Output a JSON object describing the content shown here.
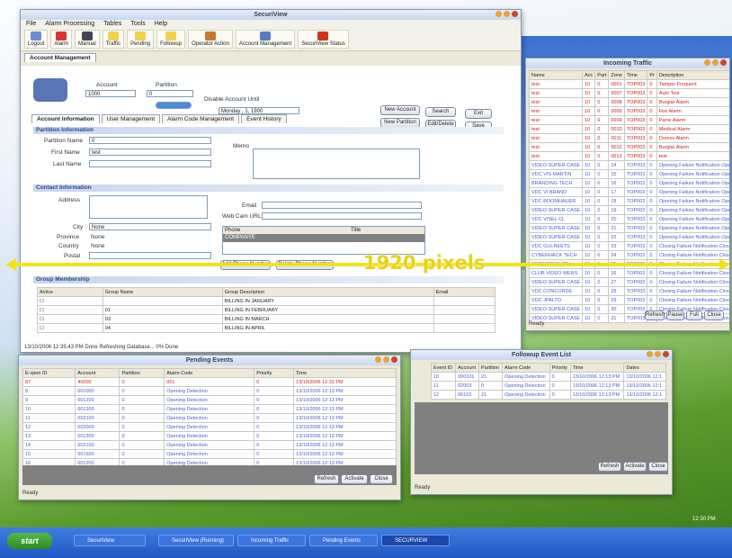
{
  "annotation_text": "1920 pixels",
  "main_window": {
    "title": "SecuriView",
    "menu": [
      "File",
      "Alarm Processing",
      "Tables",
      "Tools",
      "Help"
    ],
    "toolbar": [
      "Logout",
      "Alarm",
      "Manual",
      "Traffic",
      "Pending",
      "Followup",
      "Operator Action",
      "Account Management",
      "SecuriView Status"
    ],
    "doc_tab": "Account Management",
    "account_label": "Account",
    "account_value": "1000",
    "partition_label": "Partition",
    "partition_value": "0",
    "disable_label": "Disable Account Until",
    "date_value": "Monday , 1, 1900",
    "buttons": {
      "new_account": "New Account",
      "search": "Search",
      "exit": "Exit",
      "new_partition": "New Partition",
      "edit_delete": "Edit/Delete",
      "save": "Save"
    },
    "sub_tabs": [
      "Account Information",
      "User Management",
      "Alarm Code Management",
      "Event History"
    ],
    "partition_info": "Partition Information",
    "partition_name_label": "Partition Name",
    "partition_name_value": "0",
    "first_name_label": "First Name",
    "first_name_value": "test",
    "last_name_label": "Last Name",
    "memo_label": "Memo",
    "contact_info": "Contact Information",
    "address_label": "Address",
    "email_label": "Email",
    "webcam_label": "Web Cam URL",
    "city_label": "City",
    "city_value": "None",
    "province_label": "Province",
    "province_value": "None",
    "country_label": "Country",
    "country_value": "None",
    "postal_label": "Postal",
    "phone_headers": [
      "Phone",
      "Title"
    ],
    "phone_row": "COMPANYE",
    "add_phone": "Add Phone Number",
    "delete_phone": "Delete Phone Number",
    "group_title": "Group Membership",
    "group_headers": [
      "Active",
      "Group Name",
      "Group Description",
      "Email"
    ],
    "group_rows": [
      [
        "",
        "BILLING IN JANUARY"
      ],
      [
        "01",
        "BILLING IN FEBRUARY"
      ],
      [
        "03",
        "BILLING IN MARCH"
      ],
      [
        "04",
        "BILLING IN APRIL"
      ]
    ],
    "status": "13/10/2006 12:35:43 PM   Done Refreshing Database... 0% Done"
  },
  "incoming_traffic": {
    "title": "Incoming Traffic",
    "headers": [
      "Name",
      "Acc",
      "Part",
      "Zone",
      "Time",
      "Pr",
      "Description"
    ],
    "rows": [
      [
        "test",
        "10",
        "0",
        "0001",
        "TOP003",
        "0",
        "Tamper Frequent"
      ],
      [
        "test",
        "10",
        "0",
        "0007",
        "TOP003",
        "0",
        "Auto Test"
      ],
      [
        "test",
        "10",
        "0",
        "0008",
        "TOP003",
        "0",
        "Burglar Alarm"
      ],
      [
        "test",
        "10",
        "0",
        "0009",
        "TOP003",
        "0",
        "Fire Alarm"
      ],
      [
        "test",
        "10",
        "0",
        "0009",
        "TOP003",
        "0",
        "Panic Alarm"
      ],
      [
        "test",
        "10",
        "0",
        "0010",
        "TOP003",
        "0",
        "Medical Alarm"
      ],
      [
        "test",
        "10",
        "0",
        "0011",
        "TOP003",
        "0",
        "Duress Alarm"
      ],
      [
        "test",
        "10",
        "0",
        "0012",
        "TOP003",
        "0",
        "Burglar Alarm"
      ],
      [
        "test",
        "10",
        "0",
        "0013",
        "TOP003",
        "0",
        "test"
      ],
      [
        "VIDEO SUPER CASE",
        "10",
        "0",
        "14",
        "TOP003",
        "0",
        "Opening Failure Notification Opening"
      ],
      [
        "VDC VIS MARTIN",
        "10",
        "0",
        "15",
        "TOP003",
        "0",
        "Opening Failure Notification Opening"
      ],
      [
        "BRANDING TECH",
        "10",
        "0",
        "16",
        "TOP003",
        "0",
        "Opening Failure Notification Opening"
      ],
      [
        "VDC VI BRAND",
        "10",
        "0",
        "17",
        "TOP003",
        "0",
        "Opening Failure Notification Opening"
      ],
      [
        "VDC BOOMHAUER",
        "10",
        "0",
        "18",
        "TOP003",
        "0",
        "Opening Failure Notification Opening"
      ],
      [
        "VIDEO SUPER CASE",
        "10",
        "0",
        "19",
        "TOP003",
        "0",
        "Opening Failure Notification Opening"
      ],
      [
        "VDC VISEL CL",
        "10",
        "0",
        "20",
        "TOP003",
        "0",
        "Opening Failure Notification Opening"
      ],
      [
        "VIDEO SUPER CASE",
        "10",
        "0",
        "21",
        "TOP003",
        "0",
        "Opening Failure Notification Opening"
      ],
      [
        "VIDEO SUPER CASE",
        "10",
        "0",
        "22",
        "TOP003",
        "0",
        "Opening Failure Notification Opening"
      ],
      [
        "VDC GULREETS",
        "10",
        "0",
        "23",
        "TOP003",
        "0",
        "Closing Failure Notification Closing"
      ],
      [
        "CYBERHACK TECH",
        "10",
        "0",
        "24",
        "TOP003",
        "0",
        "Closing Failure Notification Closing"
      ],
      [
        "NETWORKS CT Inc",
        "10",
        "0",
        "25",
        "TOP003",
        "0",
        "Closing Failure Notification Closing"
      ],
      [
        "CLUB VIDEO WERS",
        "10",
        "0",
        "26",
        "TOP003",
        "0",
        "Closing Failure Notification Closing"
      ],
      [
        "VIDEO SUPER CASE",
        "10",
        "0",
        "27",
        "TOP003",
        "0",
        "Closing Failure Notification Closing"
      ],
      [
        "VDC CONCORDE",
        "10",
        "0",
        "28",
        "TOP003",
        "0",
        "Closing Failure Notification Closing"
      ],
      [
        "VDC JPALTO",
        "10",
        "0",
        "29",
        "TOP003",
        "0",
        "Closing Failure Notification Closing"
      ],
      [
        "VIDEO SUPER CASE",
        "10",
        "0",
        "30",
        "TOP003",
        "0",
        "Closing Failure Notification Closing"
      ],
      [
        "VIDEO SUPER CASE",
        "10",
        "0",
        "31",
        "TOP003",
        "0",
        "Closing Failure Notification Closing"
      ]
    ],
    "buttons": [
      "Refresh",
      "Pause",
      "Full",
      "Close"
    ],
    "status": "Ready"
  },
  "pending_events": {
    "title": "Pending Events",
    "headers": [
      "E-vpen ID",
      "Account",
      "Partition",
      "Alarm Code",
      "Priority",
      "Time"
    ],
    "rows": [
      [
        "87",
        "40000",
        "0",
        "001",
        "0",
        "13/10/2006 12:31 PM"
      ],
      [
        "8",
        "001000",
        "0",
        "Opening Detection",
        "0",
        "13/10/2006 12:13 PM"
      ],
      [
        "9",
        "001200",
        "0",
        "Opening Detection",
        "0",
        "13/10/2006 12:13 PM"
      ],
      [
        "10",
        "001300",
        "0",
        "Opening Detection",
        "0",
        "13/10/2006 12:13 PM"
      ],
      [
        "11",
        "002100",
        "0",
        "Opening Detection",
        "0",
        "13/10/2006 12:13 PM"
      ],
      [
        "12",
        "002000",
        "0",
        "Opening Detection",
        "0",
        "13/10/2006 12:13 PM"
      ],
      [
        "13",
        "001300",
        "0",
        "Opening Detection",
        "0",
        "13/10/2006 12:13 PM"
      ],
      [
        "14",
        "002100",
        "0",
        "Opening Detection",
        "0",
        "13/10/2006 12:13 PM"
      ],
      [
        "15",
        "001600",
        "0",
        "Opening Detection",
        "0",
        "13/10/2006 12:13 PM"
      ],
      [
        "16",
        "001200",
        "0",
        "Opening Detection",
        "0",
        "13/10/2006 12:13 PM"
      ]
    ],
    "buttons": [
      "Refresh",
      "Activate",
      "Close"
    ],
    "status": "Ready"
  },
  "followup_events": {
    "title": "Followup Event List",
    "headers": [
      "Event ID",
      "Account",
      "Partition",
      "Alarm Code",
      "Priority",
      "Time",
      "Dates"
    ],
    "rows": [
      [
        "10",
        "000101",
        "21",
        "Opening Detection",
        "0",
        "13/10/2006 12:13 PM",
        "13/10/2006 12:1"
      ],
      [
        "11",
        "02003",
        "0",
        "Opening Detection",
        "0",
        "13/10/2006 12:13 PM",
        "13/10/2006 12:1"
      ],
      [
        "12",
        "06102",
        "21",
        "Opening Detection",
        "0",
        "13/10/2006 12:13 PM",
        "13/10/2006 12:1"
      ]
    ],
    "buttons": [
      "Refresh",
      "Activate",
      "Close"
    ],
    "status": "Ready"
  },
  "taskbar": {
    "start": "start",
    "items": [
      "SecuriView",
      "SecuriView (Running)",
      "Incoming Traffic",
      "Pending Events",
      "SECURVIEW"
    ],
    "clock": "12:30 PM"
  }
}
